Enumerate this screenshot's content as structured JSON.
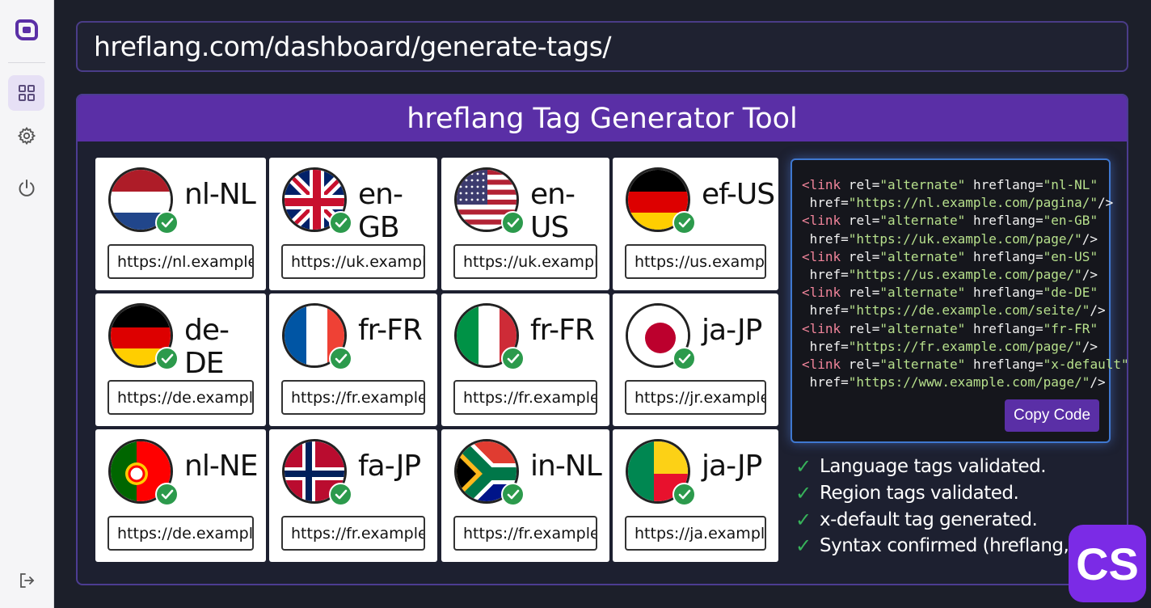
{
  "sidebar": {
    "items": [
      {
        "icon": "logo-icon"
      },
      {
        "icon": "grid-icon",
        "active": true
      },
      {
        "icon": "gear-icon"
      },
      {
        "icon": "power-icon"
      },
      {
        "icon": "logout-icon"
      }
    ]
  },
  "address_bar": {
    "url": "hreflang.com/dashboard/generate-tags/"
  },
  "tool": {
    "title": "hreflang Tag Generator Tool"
  },
  "cards": [
    {
      "code": "nl-NL",
      "url": "https://nl.example...",
      "flag": "netherlands"
    },
    {
      "code": "en-GB",
      "url": "https://uk.exampl...",
      "flag": "united-kingdom"
    },
    {
      "code": "en-US",
      "url": "https://uk.exampl...",
      "flag": "united-states"
    },
    {
      "code": "ef-US",
      "url": "https://us.exampl...",
      "flag": "germany"
    },
    {
      "code": "de-DE",
      "url": "https://de.exampl...",
      "flag": "germany"
    },
    {
      "code": "fr-FR",
      "url": "https://fr.example...",
      "flag": "france"
    },
    {
      "code": "fr-FR",
      "url": "https://fr.example...",
      "flag": "italy"
    },
    {
      "code": "ja-JP",
      "url": "https://jr.example...",
      "flag": "japan"
    },
    {
      "code": "nl-NE",
      "url": "https://de.example...",
      "flag": "portugal"
    },
    {
      "code": "fa-JP",
      "url": "https://fr.example...",
      "flag": "norway"
    },
    {
      "code": "in-NL",
      "url": "https://fr.example...",
      "flag": "south-africa"
    },
    {
      "code": "ja-JP",
      "url": "https://ja.example...",
      "flag": "benin"
    }
  ],
  "code_output": {
    "lines": [
      [
        {
          "c": "t",
          "v": "<link"
        },
        {
          "c": "a",
          "v": " rel="
        },
        {
          "c": "s",
          "v": "\"alternate\""
        },
        {
          "c": "a",
          "v": " hreflang="
        },
        {
          "c": "s",
          "v": "\"nl-NL\""
        }
      ],
      [
        {
          "c": "a",
          "v": " href="
        },
        {
          "c": "s",
          "v": "\"https://nl.example.com/pagina/\""
        },
        {
          "c": "a",
          "v": "/>"
        }
      ],
      [
        {
          "c": "t",
          "v": "<link"
        },
        {
          "c": "a",
          "v": " rel="
        },
        {
          "c": "s",
          "v": "\"alternate\""
        },
        {
          "c": "a",
          "v": " hreflang="
        },
        {
          "c": "s",
          "v": "\"en-GB\""
        }
      ],
      [
        {
          "c": "a",
          "v": " href="
        },
        {
          "c": "s",
          "v": "\"https://uk.example.com/page/\""
        },
        {
          "c": "a",
          "v": "/>"
        }
      ],
      [
        {
          "c": "t",
          "v": "<link"
        },
        {
          "c": "a",
          "v": " rel="
        },
        {
          "c": "s",
          "v": "\"alternate\""
        },
        {
          "c": "a",
          "v": " hreflang="
        },
        {
          "c": "s",
          "v": "\"en-US\""
        }
      ],
      [
        {
          "c": "a",
          "v": " href="
        },
        {
          "c": "s",
          "v": "\"https://us.example.com/page/\""
        },
        {
          "c": "a",
          "v": "/>"
        }
      ],
      [
        {
          "c": "t",
          "v": "<link"
        },
        {
          "c": "a",
          "v": " rel="
        },
        {
          "c": "s",
          "v": "\"alternate\""
        },
        {
          "c": "a",
          "v": " hreflang="
        },
        {
          "c": "s",
          "v": "\"de-DE\""
        }
      ],
      [
        {
          "c": "a",
          "v": " href="
        },
        {
          "c": "s",
          "v": "\"https://de.example.com/seite/\""
        },
        {
          "c": "a",
          "v": "/>"
        }
      ],
      [
        {
          "c": "t",
          "v": "<link"
        },
        {
          "c": "a",
          "v": " rel="
        },
        {
          "c": "s",
          "v": "\"alternate\""
        },
        {
          "c": "a",
          "v": " hreflang="
        },
        {
          "c": "s",
          "v": "\"fr-FR\""
        }
      ],
      [
        {
          "c": "a",
          "v": " href="
        },
        {
          "c": "s",
          "v": "\"https://fr.example.com/page/\""
        },
        {
          "c": "a",
          "v": "/>"
        }
      ],
      [
        {
          "c": "t",
          "v": "<link"
        },
        {
          "c": "a",
          "v": " rel="
        },
        {
          "c": "s",
          "v": "\"alternate\""
        },
        {
          "c": "a",
          "v": " hreflang="
        },
        {
          "c": "s",
          "v": "\"x-default\""
        }
      ],
      [
        {
          "c": "a",
          "v": " href="
        },
        {
          "c": "s",
          "v": "\"https://www.example.com/page/\""
        },
        {
          "c": "a",
          "v": "/>"
        }
      ]
    ],
    "copy_label": "Copy Code"
  },
  "validations": [
    "Language tags validated.",
    "Region tags validated.",
    "x-default tag generated.",
    "Syntax confirmed (hreflang, href)"
  ],
  "validation_mark": "✓",
  "badge": {
    "text": "CS"
  },
  "colors": {
    "accent": "#5a2fa6",
    "success": "#2c9a4c",
    "code_border": "#3f78d0"
  }
}
